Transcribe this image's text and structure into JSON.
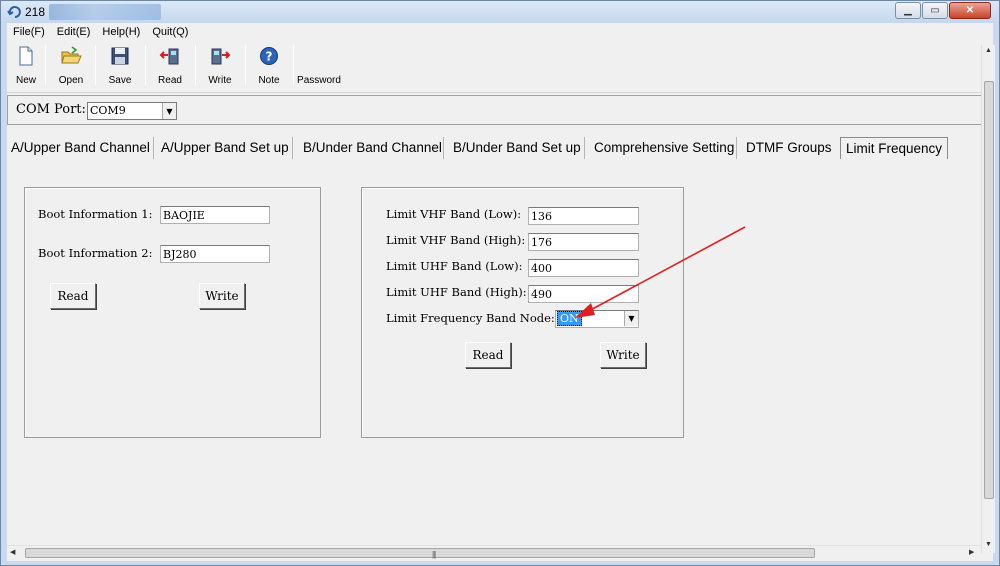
{
  "window": {
    "title": "218"
  },
  "menu": {
    "items": [
      "File(F)",
      "Edit(E)",
      "Help(H)",
      "Quit(Q)"
    ]
  },
  "toolbar": {
    "new_label": "New",
    "open_label": "Open",
    "save_label": "Save",
    "read_label": "Read",
    "write_label": "Write",
    "note_label": "Note",
    "password_label": "Password"
  },
  "com": {
    "label": "COM Port:",
    "value": "COM9"
  },
  "tabs": [
    "A/Upper Band Channel",
    "A/Upper Band Set up",
    "B/Under Band Channel",
    "B/Under Band Set up",
    "Comprehensive Setting",
    "DTMF Groups",
    "Limit Frequency"
  ],
  "boot": {
    "info1_label": "Boot Information 1:",
    "info1_value": "BAOJIE",
    "info2_label": "Boot Information 2:",
    "info2_value": "BJ280",
    "read_label": "Read",
    "write_label": "Write"
  },
  "limit": {
    "vhf_low_label": "Limit VHF Band (Low):",
    "vhf_low_value": "136",
    "vhf_high_label": "Limit VHF Band (High):",
    "vhf_high_value": "176",
    "uhf_low_label": "Limit UHF Band (Low):",
    "uhf_low_value": "400",
    "uhf_high_label": "Limit UHF Band (High):",
    "uhf_high_value": "490",
    "mode_label": "Limit Frequency Band Node:",
    "mode_value": "ON",
    "read_label": "Read",
    "write_label": "Write"
  },
  "colors": {
    "annotation_arrow": "#e02020",
    "selection": "#3399ff"
  }
}
